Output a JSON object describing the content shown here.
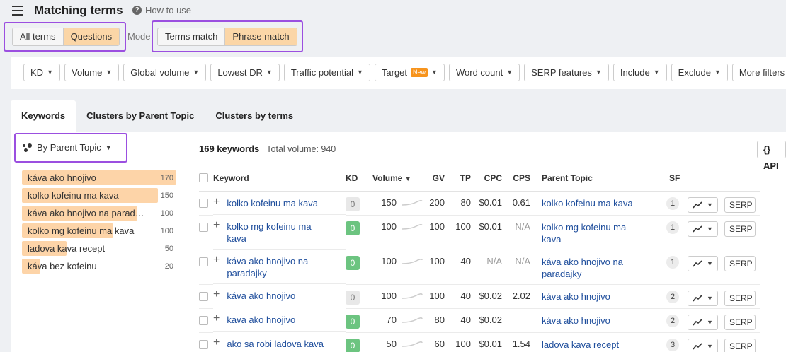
{
  "header": {
    "title": "Matching terms",
    "how_to": "How to use",
    "mode_label": "Mode",
    "segment_terms": {
      "all": "All terms",
      "questions": "Questions"
    },
    "segment_match": {
      "terms": "Terms match",
      "phrase": "Phrase match"
    }
  },
  "filters": [
    "KD",
    "Volume",
    "Global volume",
    "Lowest DR",
    "Traffic potential",
    "Target",
    "Word count",
    "SERP features",
    "Include",
    "Exclude",
    "More filters"
  ],
  "new_badge": "New",
  "tabs": [
    "Keywords",
    "Clusters by Parent Topic",
    "Clusters by terms"
  ],
  "group_by": "By Parent Topic",
  "parent_topics": [
    {
      "label": "káva ako hnojivo",
      "count": "170",
      "fraction": 1.0
    },
    {
      "label": "kolko kofeinu ma kava",
      "count": "150",
      "fraction": 0.88
    },
    {
      "label": "káva ako hnojivo na paradajky",
      "count": "100",
      "fraction": 0.0
    },
    {
      "label": "kolko mg kofeinu ma kava",
      "count": "100",
      "fraction": 0.59
    },
    {
      "label": "ladova kava recept",
      "count": "50",
      "fraction": 0.29
    },
    {
      "label": "káva bez kofeinu",
      "count": "20",
      "fraction": 0.12
    }
  ],
  "summary": {
    "count": "169 keywords",
    "volume": "Total volume: 940"
  },
  "api_label": "{} API",
  "columns": {
    "keyword": "Keyword",
    "kd": "KD",
    "volume": "Volume",
    "gv": "GV",
    "tp": "TP",
    "cpc": "CPC",
    "cps": "CPS",
    "parent_topic": "Parent Topic",
    "sf": "SF"
  },
  "serp_label": "SERP",
  "rows": [
    {
      "keyword": "kolko kofeinu ma kava",
      "kd": "0",
      "kd_color": "grey",
      "volume": "150",
      "gv": "200",
      "tp": "80",
      "cpc": "$0.01",
      "cps": "0.61",
      "parent": "kolko kofeinu ma kava",
      "sf": "1",
      "tall": false
    },
    {
      "keyword": "kolko mg kofeinu ma kava",
      "kd": "0",
      "kd_color": "green",
      "volume": "100",
      "gv": "100",
      "tp": "100",
      "cpc": "$0.01",
      "cps": "N/A",
      "parent": "kolko mg kofeinu ma kava",
      "sf": "1",
      "tall": true
    },
    {
      "keyword": "káva ako hnojivo na paradajky",
      "kd": "0",
      "kd_color": "green",
      "volume": "100",
      "gv": "100",
      "tp": "40",
      "cpc": "N/A",
      "cps": "N/A",
      "parent": "káva ako hnojivo na paradajky",
      "sf": "1",
      "tall": true
    },
    {
      "keyword": "káva ako hnojivo",
      "kd": "0",
      "kd_color": "grey",
      "volume": "100",
      "gv": "100",
      "tp": "40",
      "cpc": "$0.02",
      "cps": "2.02",
      "parent": "káva ako hnojivo",
      "sf": "2",
      "tall": false
    },
    {
      "keyword": "kava ako hnojivo",
      "kd": "0",
      "kd_color": "green",
      "volume": "70",
      "gv": "80",
      "tp": "40",
      "cpc": "$0.02",
      "cps": "",
      "parent": "káva ako hnojivo",
      "sf": "2",
      "tall": false
    },
    {
      "keyword": "ako sa robi ladova kava",
      "kd": "0",
      "kd_color": "green",
      "volume": "50",
      "gv": "60",
      "tp": "100",
      "cpc": "$0.01",
      "cps": "1.54",
      "parent": "ladova kava recept",
      "sf": "3",
      "tall": false
    }
  ],
  "colors": {
    "accent": "#fbd6a7",
    "highlight": "#9b4fe0",
    "link": "#1f4e9c",
    "kd_green": "#6cc480"
  }
}
